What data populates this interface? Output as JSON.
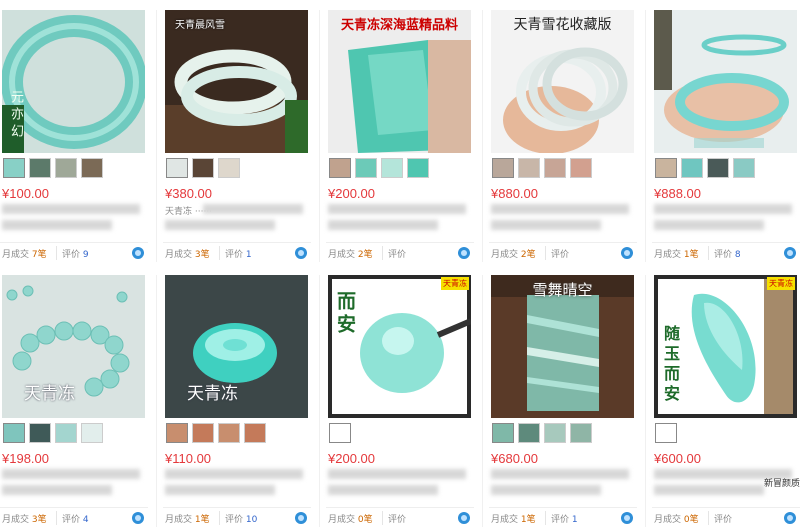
{
  "products": [
    {
      "price": "¥100.00",
      "sales_label": "月成交",
      "sales_count": "7笔",
      "review_label": "评价",
      "review_count": "9",
      "thumb_text": "",
      "side_text": "元亦幻",
      "banner": "",
      "badge": "",
      "brand": "",
      "blurred_title": "天青色 ······"
    },
    {
      "price": "¥380.00",
      "sales_label": "月成交",
      "sales_count": "3笔",
      "review_label": "评价",
      "review_count": "1",
      "thumb_text": "天青晨风雪",
      "side_text": "",
      "banner": "",
      "badge": "",
      "brand": "",
      "blurred_title": "天青冻 ······"
    },
    {
      "price": "¥200.00",
      "sales_label": "月成交",
      "sales_count": "2笔",
      "review_label": "评价",
      "review_count": "",
      "thumb_text": "",
      "side_text": "",
      "banner": "天青冻深海蓝精品料",
      "badge": "",
      "brand": "",
      "blurred_title": ""
    },
    {
      "price": "¥880.00",
      "sales_label": "月成交",
      "sales_count": "2笔",
      "review_label": "评价",
      "review_count": "",
      "thumb_text": "",
      "side_text": "",
      "banner": "天青雪花收藏版",
      "badge": "",
      "brand": "",
      "blurred_title": ""
    },
    {
      "price": "¥888.00",
      "sales_label": "月成交",
      "sales_count": "1笔",
      "review_label": "评价",
      "review_count": "8",
      "thumb_text": "",
      "side_text": "",
      "banner": "",
      "badge": "",
      "brand": "",
      "blurred_title": ""
    },
    {
      "price": "¥198.00",
      "sales_label": "月成交",
      "sales_count": "3笔",
      "review_label": "评价",
      "review_count": "4",
      "thumb_text": "",
      "side_text": "",
      "banner": "",
      "badge": "",
      "brand": "天青冻",
      "blurred_title": ""
    },
    {
      "price": "¥110.00",
      "sales_label": "月成交",
      "sales_count": "1笔",
      "review_label": "评价",
      "review_count": "10",
      "thumb_text": "",
      "side_text": "",
      "banner": "",
      "badge": "",
      "brand": "天青冻",
      "blurred_title": ""
    },
    {
      "price": "¥200.00",
      "sales_label": "月成交",
      "sales_count": "0笔",
      "review_label": "评价",
      "review_count": "",
      "thumb_text": "",
      "side_text": "而安",
      "banner": "",
      "badge": "天青冻",
      "brand": "",
      "blurred_title": ""
    },
    {
      "price": "¥680.00",
      "sales_label": "月成交",
      "sales_count": "1笔",
      "review_label": "评价",
      "review_count": "1",
      "thumb_text": "",
      "side_text": "",
      "banner": "雪舞晴空",
      "badge": "",
      "brand": "",
      "blurred_title": ""
    },
    {
      "price": "¥600.00",
      "sales_label": "月成交",
      "sales_count": "0笔",
      "review_label": "评价",
      "review_count": "",
      "thumb_text": "",
      "side_text": "随玉而安",
      "banner": "",
      "badge": "天青冻",
      "brand": "",
      "blurred_title": ""
    }
  ],
  "extra_label": "新冒颜质",
  "colors": {
    "price": "#e4393c",
    "jade": "#7fd3c8",
    "link": "#3366cc"
  }
}
